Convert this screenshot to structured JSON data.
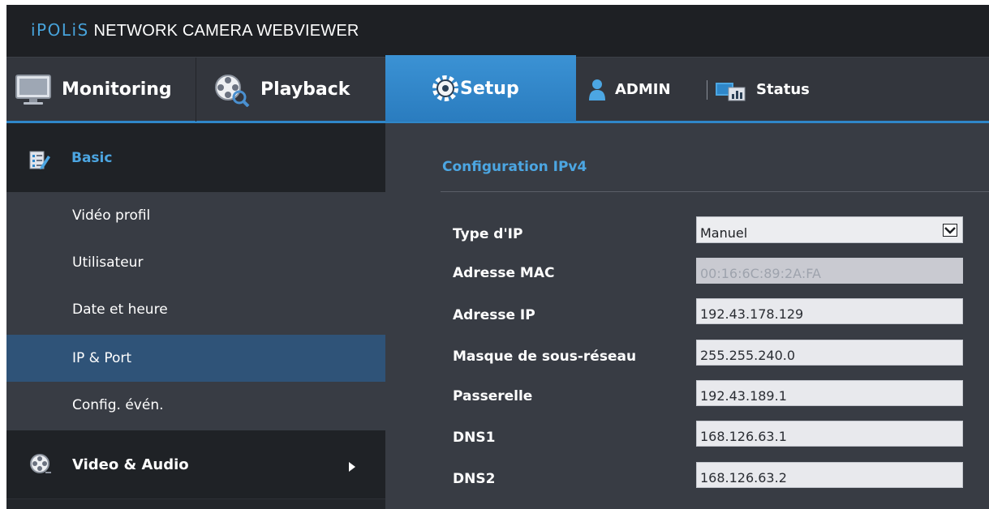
{
  "app": {
    "brand_logo": "iPOLiS",
    "brand_rest": " NETWORK CAMERA WEBVIEWER"
  },
  "nav": {
    "monitoring": "Monitoring",
    "playback": "Playback",
    "setup": "Setup",
    "admin": "ADMIN",
    "status": "Status"
  },
  "sidebar": {
    "basic": "Basic",
    "sub_items": [
      {
        "label": "Vidéo profil"
      },
      {
        "label": "Utilisateur"
      },
      {
        "label": "Date et heure"
      },
      {
        "label": "IP & Port",
        "active": true
      },
      {
        "label": "Config. évén."
      }
    ],
    "video_audio": "Video & Audio"
  },
  "main": {
    "section_title": "Configuration IPv4",
    "fields": [
      {
        "label": "Type d'IP",
        "value": "Manuel",
        "kind": "select"
      },
      {
        "label": "Adresse MAC",
        "value": "00:16:6C:89:2A:FA",
        "kind": "readonly"
      },
      {
        "label": "Adresse IP",
        "value": "192.43.178.129",
        "kind": "text"
      },
      {
        "label": "Masque de sous-réseau",
        "value": "255.255.240.0",
        "kind": "text"
      },
      {
        "label": "Passerelle",
        "value": "192.43.189.1",
        "kind": "text"
      },
      {
        "label": "DNS1",
        "value": "168.126.63.1",
        "kind": "text"
      },
      {
        "label": "DNS2",
        "value": "168.126.63.2",
        "kind": "text"
      }
    ]
  },
  "colors": {
    "accent": "#2f87c9",
    "accent_text": "#4ca6e2",
    "active_row": "#2f5378"
  },
  "icons": {
    "monitoring": "monitor-icon",
    "playback": "film-reel-search-icon",
    "setup": "gear-icon",
    "admin": "user-icon",
    "status": "status-chart-icon",
    "basic": "checklist-edit-icon",
    "video_audio": "film-reel-icon"
  }
}
